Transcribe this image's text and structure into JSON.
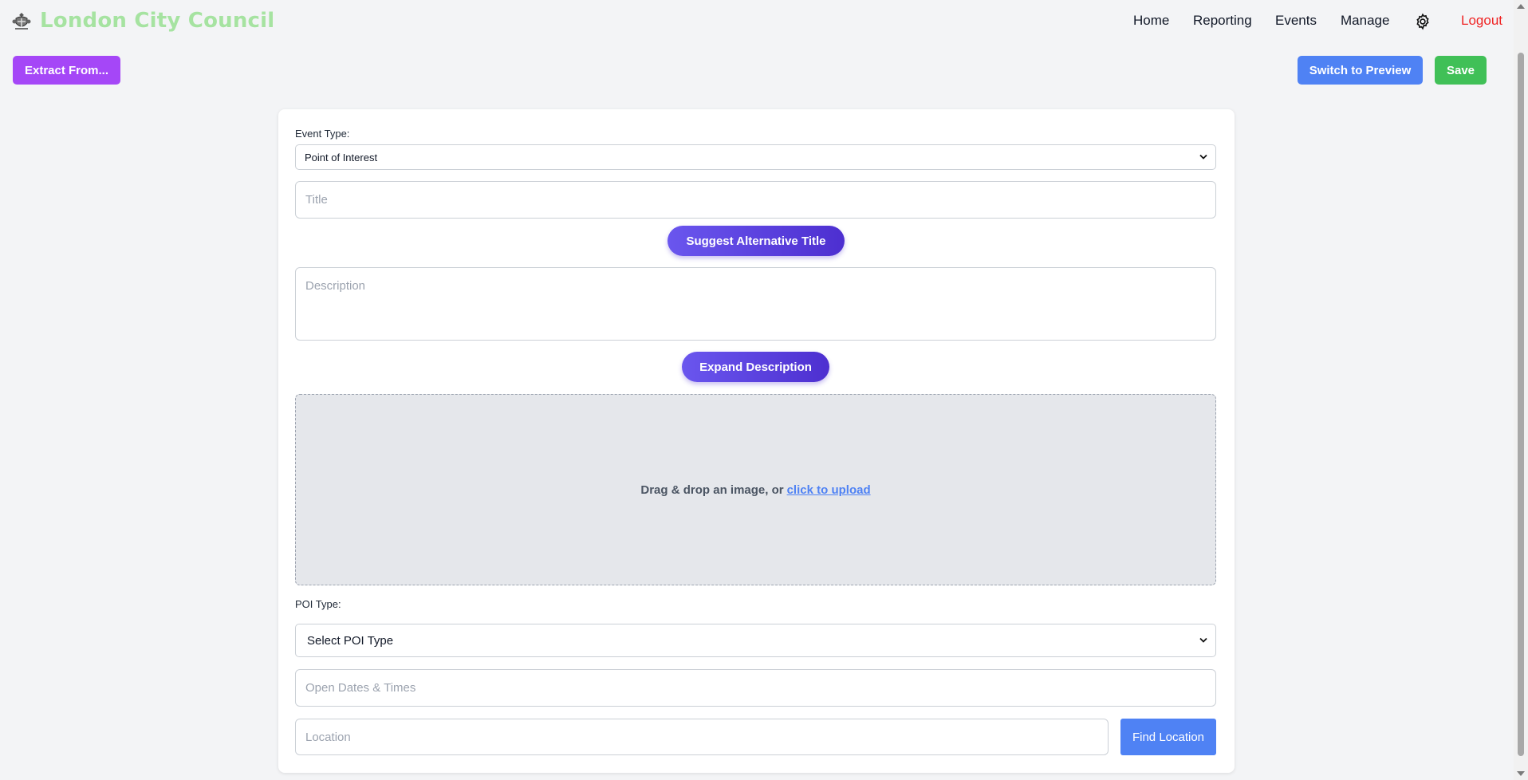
{
  "header": {
    "brand": "London City Council",
    "brand_color": "#a6e3a1",
    "logo_icon": "crest-icon",
    "nav": [
      {
        "label": "Home"
      },
      {
        "label": "Reporting"
      },
      {
        "label": "Events"
      },
      {
        "label": "Manage"
      }
    ],
    "settings_icon": "gear-icon",
    "logout_label": "Logout",
    "logout_color": "#ef2323"
  },
  "toolbar": {
    "extract_label": "Extract From...",
    "extract_color": "#a547f7",
    "preview_label": "Switch to Preview",
    "preview_color": "#4f82f4",
    "save_label": "Save",
    "save_color": "#40c057"
  },
  "form": {
    "event_type_label": "Event Type:",
    "event_type_value": "Point of Interest",
    "title_placeholder": "Title",
    "suggest_title_label": "Suggest Alternative Title",
    "description_placeholder": "Description",
    "expand_description_label": "Expand Description",
    "dropzone_text": "Drag & drop an image, or",
    "dropzone_link": "click to upload",
    "poi_type_label": "POI Type:",
    "poi_type_value": "Select POI Type",
    "open_dates_placeholder": "Open Dates & Times",
    "location_placeholder": "Location",
    "find_location_label": "Find Location"
  }
}
